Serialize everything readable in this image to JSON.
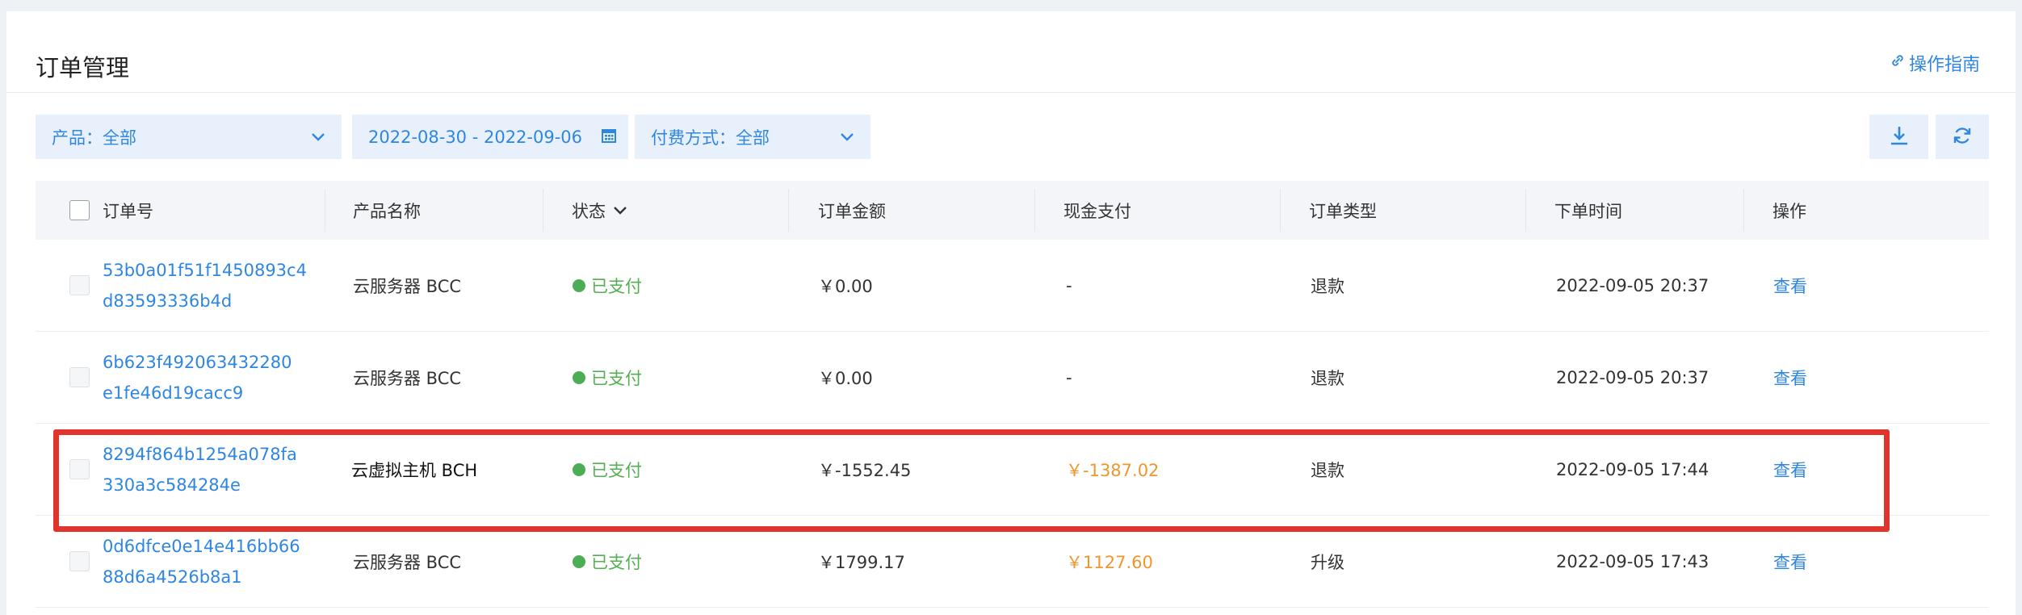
{
  "header": {
    "title": "订单管理",
    "guide_label": "操作指南",
    "guide_icon": "link-icon"
  },
  "filters": {
    "product": "产品：全部",
    "date_range": "2022-08-30 - 2022-09-06",
    "payment": "付费方式：全部"
  },
  "toolbar": {
    "download_icon": "download-icon",
    "refresh_icon": "refresh-icon"
  },
  "table": {
    "columns": [
      "订单号",
      "产品名称",
      "状态",
      "订单金额",
      "现金支付",
      "订单类型",
      "下单时间",
      "操作"
    ],
    "rows": [
      {
        "order_line1": "53b0a01f51f1450893c4",
        "order_line2": "d83593336b4d",
        "product": "云服务器 BCC",
        "status": "已支付",
        "amount": "￥0.00",
        "cash": "-",
        "type": "退款",
        "time": "2022-09-05 20:37",
        "action": "查看"
      },
      {
        "order_line1": "6b623f492063432280",
        "order_line2": "e1fe46d19cacc9",
        "product": "云服务器 BCC",
        "status": "已支付",
        "amount": "￥0.00",
        "cash": "-",
        "type": "退款",
        "time": "2022-09-05 20:37",
        "action": "查看"
      },
      {
        "order_line1": "8294f864b1254a078fa",
        "order_line2": "330a3c584284e",
        "product": "云虚拟主机 BCH",
        "status": "已支付",
        "amount": "￥-1552.45",
        "cash": "￥-1387.02",
        "type": "退款",
        "time": "2022-09-05 17:44",
        "action": "查看"
      },
      {
        "order_line1": "0d6dfce0e14e416bb66",
        "order_line2": "88d6a4526b8a1",
        "product": "云服务器 BCC",
        "status": "已支付",
        "amount": "￥1799.17",
        "cash": "￥1127.60",
        "type": "升级",
        "time": "2022-09-05 17:43",
        "action": "查看"
      }
    ]
  },
  "colors": {
    "accent": "#2f86e0",
    "paid_green": "#4cad55",
    "cash_orange": "#f0962c",
    "highlight_red": "#e0342c"
  }
}
